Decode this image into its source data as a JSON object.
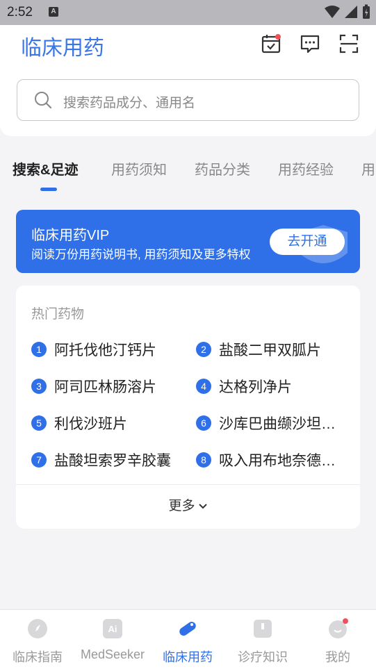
{
  "status_bar": {
    "time": "2:52",
    "a_icon": "A"
  },
  "header": {
    "logo": "临床用药",
    "icons": [
      "calendar-check-icon",
      "message-icon",
      "scan-icon"
    ]
  },
  "search": {
    "placeholder": "搜索药品成分、通用名"
  },
  "tabs": [
    {
      "label": "搜索&足迹",
      "active": true
    },
    {
      "label": "用药须知"
    },
    {
      "label": "药品分类"
    },
    {
      "label": "用药经验"
    },
    {
      "label": "用"
    }
  ],
  "vip": {
    "title": "临床用药VIP",
    "subtitle": "阅读万份用药说明书, 用药须知及更多特权",
    "button": "去开通"
  },
  "hot": {
    "title": "热门药物",
    "items": [
      {
        "num": "1",
        "name": "阿托伐他汀钙片"
      },
      {
        "num": "2",
        "name": "盐酸二甲双胍片"
      },
      {
        "num": "3",
        "name": "阿司匹林肠溶片"
      },
      {
        "num": "4",
        "name": "达格列净片"
      },
      {
        "num": "5",
        "name": "利伐沙班片"
      },
      {
        "num": "6",
        "name": "沙库巴曲缬沙坦…"
      },
      {
        "num": "7",
        "name": "盐酸坦索罗辛胶囊"
      },
      {
        "num": "8",
        "name": "吸入用布地奈德…"
      }
    ],
    "more": "更多"
  },
  "nav": [
    {
      "label": "临床指南",
      "icon": "compass-icon"
    },
    {
      "label": "MedSeeker",
      "icon": "ai-icon"
    },
    {
      "label": "临床用药",
      "icon": "pill-icon",
      "active": true
    },
    {
      "label": "诊疗知识",
      "icon": "book-icon"
    },
    {
      "label": "我的",
      "icon": "profile-icon"
    }
  ],
  "colors": {
    "accent": "#2f6fe8",
    "badge": "#f0505a"
  }
}
